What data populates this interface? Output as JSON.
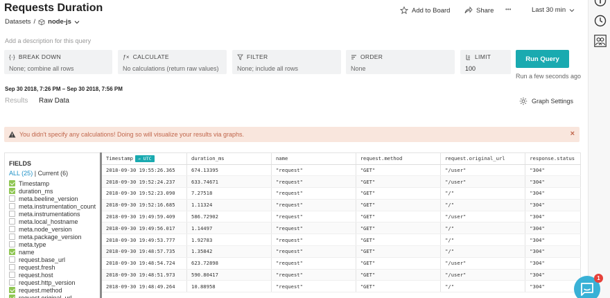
{
  "header": {
    "title": "Requests Duration",
    "breadcrumb_root": "Datasets",
    "breadcrumb_sep": "/",
    "dataset": "node-js",
    "description_placeholder": "Add a description for this query",
    "add_to_board": "Add to Board",
    "share": "Share",
    "more": "•••",
    "time_range": "Last 30 min"
  },
  "query": {
    "breakdown": {
      "label": "BREAK DOWN",
      "value": "None; combine all rows"
    },
    "calculate": {
      "label": "CALCULATE",
      "value": "No calculations (return raw values)"
    },
    "filter": {
      "label": "FILTER",
      "value": "None; include all rows"
    },
    "order": {
      "label": "ORDER",
      "value": "None"
    },
    "limit": {
      "label": "LIMIT",
      "value": "100"
    },
    "run_label": "Run Query",
    "run_hint": "Run a few seconds ago"
  },
  "results": {
    "range": "Sep 30 2018, 7:26 PM – Sep 30 2018, 7:56 PM",
    "tab_results": "Results",
    "tab_raw": "Raw Data",
    "graph_settings": "Graph Settings",
    "warning": "You didn't specify any calculations! Doing so will visualize your results via graphs.",
    "warning_close": "×"
  },
  "fields": {
    "title": "FIELDS",
    "all_label": "ALL (25)",
    "sep": "|",
    "current_label": "Current (6)",
    "items": [
      {
        "name": "Timestamp",
        "checked": true
      },
      {
        "name": "duration_ms",
        "checked": true
      },
      {
        "name": "meta.beeline_version",
        "checked": false
      },
      {
        "name": "meta.instrumentation_count",
        "checked": false
      },
      {
        "name": "meta.instrumentations",
        "checked": false
      },
      {
        "name": "meta.local_hostname",
        "checked": false
      },
      {
        "name": "meta.node_version",
        "checked": false
      },
      {
        "name": "meta.package_version",
        "checked": false
      },
      {
        "name": "meta.type",
        "checked": false
      },
      {
        "name": "name",
        "checked": true
      },
      {
        "name": "request.base_url",
        "checked": false
      },
      {
        "name": "request.fresh",
        "checked": false
      },
      {
        "name": "request.host",
        "checked": false
      },
      {
        "name": "request.http_version",
        "checked": false
      },
      {
        "name": "request.method",
        "checked": true
      },
      {
        "name": "request.original_url",
        "checked": true
      }
    ]
  },
  "table": {
    "columns": [
      "Timestamp",
      "duration_ms",
      "name",
      "request.method",
      "request.original_url",
      "response.status"
    ],
    "utc_badge": "→ UTC",
    "rows": [
      [
        "2018-09-30 19:55:26.365",
        "674.13395",
        "\"request\"",
        "\"GET\"",
        "\"/user\"",
        "\"304\""
      ],
      [
        "2018-09-30 19:52:24.237",
        "633.74671",
        "\"request\"",
        "\"GET\"",
        "\"/user\"",
        "\"304\""
      ],
      [
        "2018-09-30 19:52:23.090",
        "7.27518",
        "\"request\"",
        "\"GET\"",
        "\"/\"",
        "\"304\""
      ],
      [
        "2018-09-30 19:52:16.685",
        "1.11324",
        "\"request\"",
        "\"GET\"",
        "\"/\"",
        "\"304\""
      ],
      [
        "2018-09-30 19:49:59.409",
        "586.72902",
        "\"request\"",
        "\"GET\"",
        "\"/user\"",
        "\"304\""
      ],
      [
        "2018-09-30 19:49:56.017",
        "1.14497",
        "\"request\"",
        "\"GET\"",
        "\"/\"",
        "\"304\""
      ],
      [
        "2018-09-30 19:49:53.777",
        "1.92783",
        "\"request\"",
        "\"GET\"",
        "\"/\"",
        "\"304\""
      ],
      [
        "2018-09-30 19:48:57.735",
        "1.35842",
        "\"request\"",
        "\"GET\"",
        "\"/\"",
        "\"304\""
      ],
      [
        "2018-09-30 19:48:54.724",
        "623.72898",
        "\"request\"",
        "\"GET\"",
        "\"/user\"",
        "\"304\""
      ],
      [
        "2018-09-30 19:48:51.973",
        "590.80417",
        "\"request\"",
        "\"GET\"",
        "\"/user\"",
        "\"304\""
      ],
      [
        "2018-09-30 19:48:49.264",
        "10.88958",
        "\"request\"",
        "\"GET\"",
        "\"/\"",
        "\"304\""
      ]
    ]
  },
  "chat": {
    "badge": "1"
  },
  "colors": {
    "accent": "#1aaab0",
    "check": "#8fc653",
    "warning_bg": "#f9e6dd",
    "warning_text": "#c0664c"
  }
}
